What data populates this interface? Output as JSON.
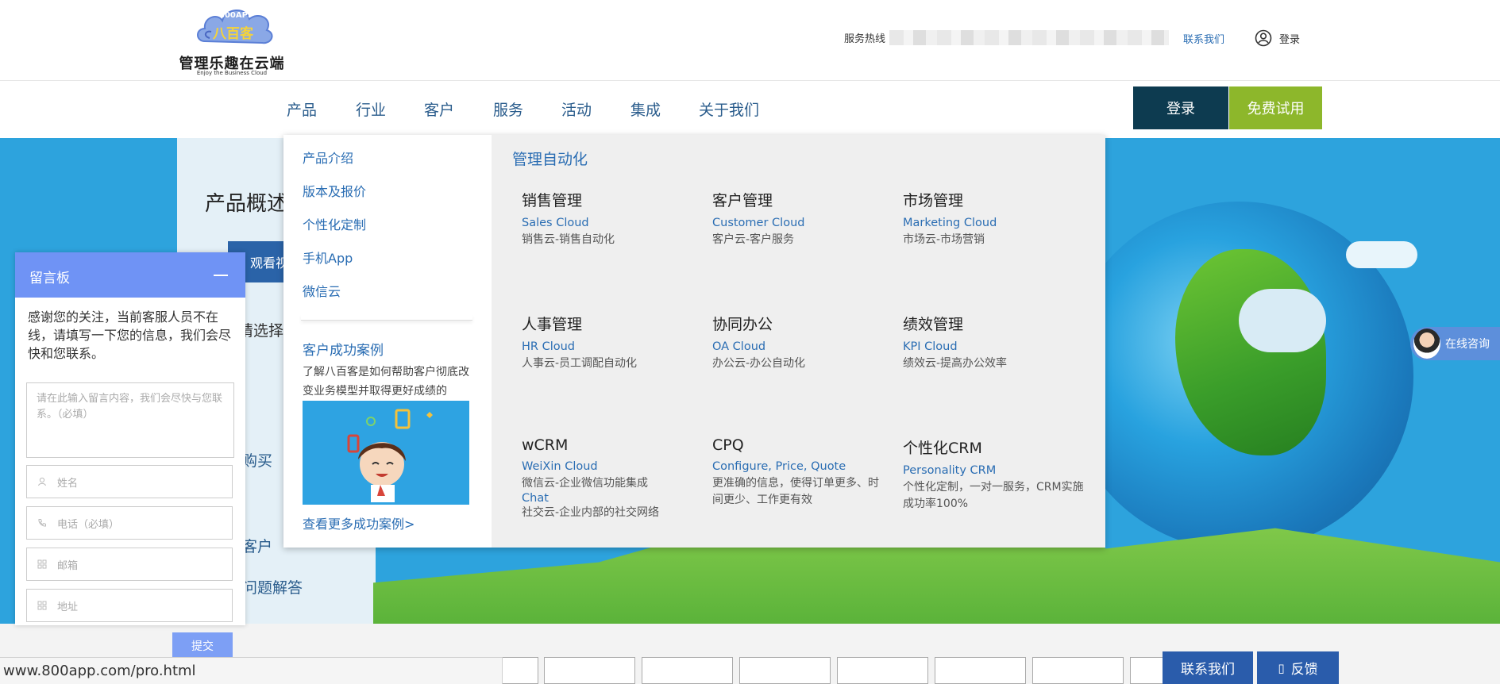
{
  "header": {
    "logo_badge": "800APP",
    "logo_name": "八百客",
    "logo_tagline": "管理乐趣在云端",
    "logo_sub": "Enjoy the Business Cloud",
    "hotline_label": "服务热线",
    "contact_link": "联系我们",
    "login_link": "登录"
  },
  "nav": {
    "items": [
      "产品",
      "行业",
      "客户",
      "服务",
      "活动",
      "集成",
      "关于我们"
    ],
    "login_button": "登录",
    "trial_button": "免费试用"
  },
  "hero": {
    "panel_title": "产品概述",
    "video_button": "观看视",
    "side_texts": [
      "请选择产",
      "购买",
      "客户",
      "问题解答"
    ]
  },
  "dropdown": {
    "left_links": [
      "产品介绍",
      "版本及报价",
      "个性化定制",
      "手机App",
      "微信云"
    ],
    "case_title": "客户成功案例",
    "case_desc": "了解八百客是如何帮助客户彻底改变业务模型并取得更好成绩的",
    "more_cases": "查看更多成功案例>",
    "section_title": "管理自动化",
    "modules": [
      {
        "title": "销售管理",
        "en": "Sales Cloud",
        "desc": "销售云-销售自动化"
      },
      {
        "title": "客户管理",
        "en": "Customer Cloud",
        "desc": "客户云-客户服务"
      },
      {
        "title": "市场管理",
        "en": "Marketing Cloud",
        "desc": "市场云-市场营销"
      },
      {
        "title": "人事管理",
        "en": "HR Cloud",
        "desc": "人事云-员工调配自动化"
      },
      {
        "title": "协同办公",
        "en": "OA Cloud",
        "desc": "办公云-办公自动化"
      },
      {
        "title": "绩效管理",
        "en": "KPI Cloud",
        "desc": "绩效云-提高办公效率"
      },
      {
        "title": "wCRM",
        "en": "WeiXin Cloud",
        "desc": "微信云-企业微信功能集成",
        "en2": "Chat",
        "desc2": "社交云-企业内部的社交网络"
      },
      {
        "title": "CPQ",
        "en": "Configure, Price, Quote",
        "desc": "更准确的信息，使得订单更多、时间更少、工作更有效"
      },
      {
        "title": "个性化CRM",
        "en": "Personality CRM",
        "desc": "个性化定制，一对一服务，CRM实施成功率100%"
      }
    ]
  },
  "message_board": {
    "title": "留言板",
    "message": "感谢您的关注，当前客服人员不在线，请填写一下您的信息，我们会尽快和您联系。",
    "textarea_placeholder": "请在此输入留言内容，我们会尽快与您联系。（必填）",
    "name_placeholder": "姓名",
    "phone_placeholder": "电话（必填）",
    "email_placeholder": "邮箱",
    "address_placeholder": "地址",
    "submit": "提交"
  },
  "floating": {
    "online_consult": "在线咨询",
    "contact_us": "联系我们",
    "feedback": "反馈",
    "feedback_icon": "▯"
  },
  "status_url": "www.800app.com/pro.html",
  "colors": {
    "nav_text": "#2a5c8c",
    "login_bg": "#0d3b50",
    "trial_bg": "#8db72b",
    "link_blue": "#2a6db3",
    "message_header": "#6f93f5",
    "floating_btn": "#2a5cab",
    "hero_sky": "#2da3dd"
  }
}
